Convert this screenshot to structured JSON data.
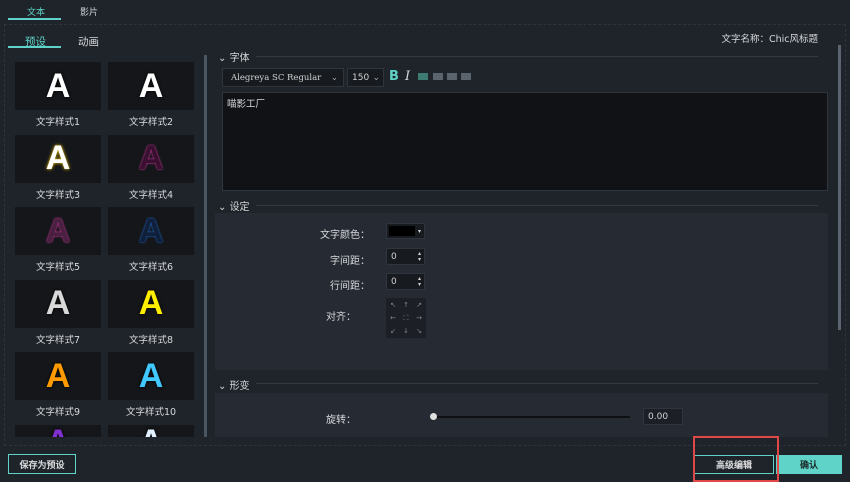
{
  "top_tabs": [
    {
      "label": "文本",
      "active": true
    },
    {
      "label": "影片",
      "active": false
    }
  ],
  "sub_tabs": [
    {
      "label": "预设",
      "active": true
    },
    {
      "label": "动画",
      "active": false
    }
  ],
  "text_name": "文字名称：Chic风标题",
  "presets": [
    {
      "label": "文字样式1",
      "color": "#ffffff"
    },
    {
      "label": "文字样式2",
      "color": "#ffffff"
    },
    {
      "label": "文字样式3",
      "color": "#ffffff"
    },
    {
      "label": "文字样式4",
      "color": "#3a1030"
    },
    {
      "label": "文字样式5",
      "color": "#4a2040"
    },
    {
      "label": "文字样式6",
      "color": "#10203a"
    },
    {
      "label": "文字样式7",
      "color": "#d8d8d8"
    },
    {
      "label": "文字样式8",
      "color": "#ffee00"
    },
    {
      "label": "文字样式9",
      "color": "#ff9a00"
    },
    {
      "label": "文字样式10",
      "color": "#40c8ff"
    },
    {
      "label": "",
      "color": "#8030d0"
    },
    {
      "label": "",
      "color": "#e0f0ff"
    }
  ],
  "preset_glyph": "A",
  "font_section": {
    "title": "字体",
    "font": "Alegreya SC Regular",
    "size": "150",
    "bold": "B",
    "italic": "I",
    "text": "喵影工厂"
  },
  "settings_section": {
    "title": "设定",
    "color_label": "文字颜色：",
    "color_value": "#000000",
    "spacing_label": "字间距：",
    "spacing": "0",
    "line_label": "行间距：",
    "line": "0",
    "align_label": "对齐：",
    "align_icons": [
      "↖",
      "↑",
      "↗",
      "←",
      "⛶",
      "→",
      "↙",
      "↓",
      "↘"
    ]
  },
  "transform_section": {
    "title": "形变",
    "rotate_label": "旋转：",
    "rotate_value": "0.00",
    "rotate_fraction": 0
  },
  "buttons": {
    "save_preset": "保存为预设",
    "advanced": "高级编辑",
    "confirm": "确认"
  },
  "accent": "#5fd3c7",
  "highlight": "#e04848"
}
